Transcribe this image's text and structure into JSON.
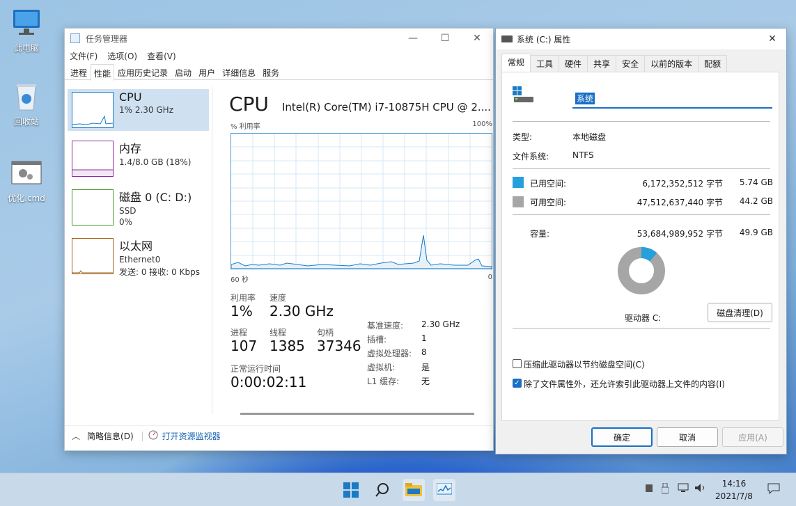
{
  "desktop": {
    "icons": [
      {
        "label": "此电脑"
      },
      {
        "label": "回收站"
      },
      {
        "label": "优化.cmd"
      }
    ]
  },
  "taskmgr": {
    "title": "任务管理器",
    "menu": [
      "文件(F)",
      "选项(O)",
      "查看(V)"
    ],
    "tabs": [
      "进程",
      "性能",
      "应用历史记录",
      "启动",
      "用户",
      "详细信息",
      "服务"
    ],
    "active_tab": "性能",
    "resources": [
      {
        "name": "CPU",
        "line1": "1% 2.30 GHz",
        "line2": "",
        "color": "#1a7bc4"
      },
      {
        "name": "内存",
        "line1": "1.4/8.0 GB (18%)",
        "line2": "",
        "color": "#8b2c9c"
      },
      {
        "name": "磁盘 0 (C: D:)",
        "line1": "SSD",
        "line2": "0%",
        "color": "#4d9a2a"
      },
      {
        "name": "以太网",
        "line1": "Ethernet0",
        "line2": "发送: 0 接收: 0 Kbps",
        "color": "#a3621b"
      }
    ],
    "detail": {
      "heading": "CPU",
      "model": "Intel(R) Core(TM) i7-10875H CPU @ 2....",
      "graph_label": "% 利用率",
      "graph_max": "100%",
      "graph_time": "60 秒",
      "graph_min": "0",
      "util_label": "利用率",
      "util": "1%",
      "speed_label": "速度",
      "speed": "2.30 GHz",
      "proc_label": "进程",
      "proc": "107",
      "thread_label": "线程",
      "thread": "1385",
      "handle_label": "句柄",
      "handle": "37346",
      "uptime_label": "正常运行时间",
      "uptime": "0:00:02:11",
      "specs": [
        {
          "k": "基准速度:",
          "v": "2.30 GHz"
        },
        {
          "k": "插槽:",
          "v": "1"
        },
        {
          "k": "虚拟处理器:",
          "v": "8"
        },
        {
          "k": "虚拟机:",
          "v": "是"
        },
        {
          "k": "L1 缓存:",
          "v": "无"
        }
      ]
    },
    "footer": {
      "summary": "简略信息(D)",
      "monitor": "打开资源监视器"
    }
  },
  "props": {
    "title": "系统 (C:) 属性",
    "tabs": [
      "常规",
      "工具",
      "硬件",
      "共享",
      "安全",
      "以前的版本",
      "配额"
    ],
    "active_tab": "常规",
    "name_value": "系统",
    "type_label": "类型:",
    "type_value": "本地磁盘",
    "fs_label": "文件系统:",
    "fs_value": "NTFS",
    "used_label": "已用空间:",
    "used_bytes": "6,172,352,512 字节",
    "used_size": "5.74 GB",
    "used_color": "#26a0da",
    "free_label": "可用空间:",
    "free_bytes": "47,512,637,440 字节",
    "free_size": "44.2 GB",
    "free_color": "#a6a6a6",
    "cap_label": "容量:",
    "cap_bytes": "53,684,989,952 字节",
    "cap_size": "49.9 GB",
    "used_fraction": 0.115,
    "drive_label": "驱动器 C:",
    "cleanup_btn": "磁盘清理(D)",
    "compress_label": "压缩此驱动器以节约磁盘空间(C)",
    "index_label": "除了文件属性外，还允许索引此驱动器上文件的内容(I)",
    "ok_btn": "确定",
    "cancel_btn": "取消",
    "apply_btn": "应用(A)"
  },
  "taskbar": {
    "time": "14:16",
    "date": "2021/7/8"
  }
}
